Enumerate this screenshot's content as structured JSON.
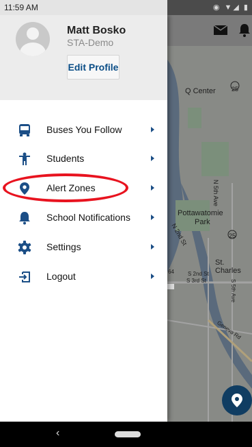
{
  "status_bar": {
    "time": "11:59 AM"
  },
  "profile": {
    "name": "Matt Bosko",
    "organization": "STA-Demo",
    "edit_label": "Edit Profile"
  },
  "menu": [
    {
      "label": "Buses You Follow",
      "icon": "bus-icon"
    },
    {
      "label": "Students",
      "icon": "student-icon"
    },
    {
      "label": "Alert Zones",
      "icon": "map-pin-icon"
    },
    {
      "label": "School Notifications",
      "icon": "bell-icon"
    },
    {
      "label": "Settings",
      "icon": "gear-icon"
    },
    {
      "label": "Logout",
      "icon": "logout-icon"
    }
  ],
  "map": {
    "labels": [
      "Q Center",
      "N 5th Ave",
      "Pottawatomie",
      "Park",
      "N 2nd St",
      "St. Charles",
      "S 2nd St",
      "S 3rd St",
      "S 5th Ave",
      "Geneva Rd"
    ],
    "route_shields": [
      "25",
      "25",
      "64"
    ]
  },
  "colors": {
    "accent": "#1b4e86",
    "highlight_ring": "#e8131f",
    "fab": "#103d62"
  }
}
